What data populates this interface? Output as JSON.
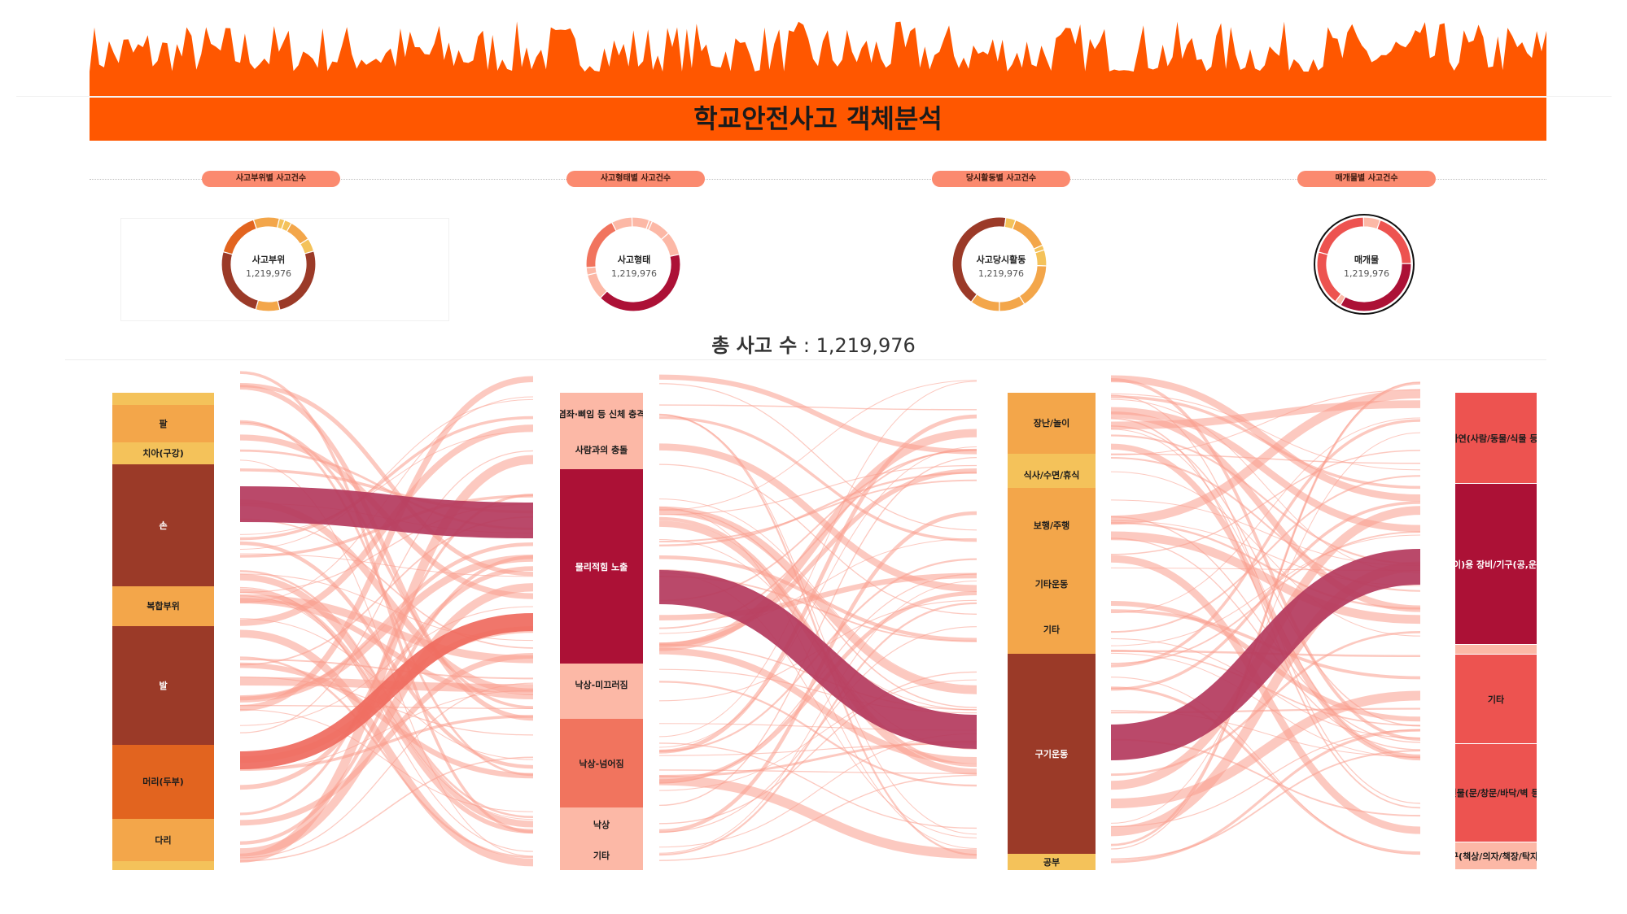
{
  "title": "학교안전사고 객체분석",
  "total": {
    "label": "총 사고 수",
    "value": "1,219,976"
  },
  "donuts": [
    {
      "pill": "사고부위별 사고건수",
      "center": "사고부위",
      "value": "1,219,976"
    },
    {
      "pill": "사고형태별 사고건수",
      "center": "사고형태",
      "value": "1,219,976"
    },
    {
      "pill": "당시활동별 사고건수",
      "center": "사고당시활동",
      "value": "1,219,976"
    },
    {
      "pill": "매개물별 사고건수",
      "center": "매개물",
      "value": "1,219,976"
    }
  ],
  "colors": {
    "accent": "#ff5700",
    "flow": "#fa9d8c",
    "flow_highlight_1": "#b43a5d",
    "flow_highlight_2": "#ef6a5e"
  },
  "chart_data": {
    "type": "sankey",
    "stages": [
      {
        "name": "사고부위",
        "nodes": [
          {
            "label": "",
            "value": 12000,
            "color": "#f4c25a"
          },
          {
            "label": "팔",
            "value": 38000,
            "color": "#f3a64a"
          },
          {
            "label": "치아(구강)",
            "value": 22000,
            "color": "#f4c25a"
          },
          {
            "label": "손",
            "value": 124000,
            "color": "#9b3a28"
          },
          {
            "label": "복합부위",
            "value": 40000,
            "color": "#f3a64a"
          },
          {
            "label": "발",
            "value": 120000,
            "color": "#9b3a28"
          },
          {
            "label": "머리(두부)",
            "value": 75000,
            "color": "#e2641f"
          },
          {
            "label": "다리",
            "value": 43000,
            "color": "#f3a64a"
          },
          {
            "label": "",
            "value": 9000,
            "color": "#f4c25a"
          }
        ]
      },
      {
        "name": "사고형태",
        "nodes": [
          {
            "label": "",
            "value": 5000,
            "color": "#fcb8a6"
          },
          {
            "label": "염좌·삐임 등 신체 충격",
            "value": 32000,
            "color": "#fcb8a6"
          },
          {
            "label": "사람과의 충돌",
            "value": 38000,
            "color": "#fcb8a6"
          },
          {
            "label": "물리적힘 노출",
            "value": 190000,
            "color": "#ac1136"
          },
          {
            "label": "낙상-미끄러짐",
            "value": 42000,
            "color": "#fcb8a6"
          },
          {
            "label": "",
            "value": 12000,
            "color": "#fcb8a6"
          },
          {
            "label": "낙상-넘어짐",
            "value": 87000,
            "color": "#f1745e"
          },
          {
            "label": "낙상",
            "value": 33000,
            "color": "#fcb8a6"
          },
          {
            "label": "기타",
            "value": 28000,
            "color": "#fcb8a6"
          }
        ]
      },
      {
        "name": "사고당시활동",
        "nodes": [
          {
            "label": "장난/놀이",
            "value": 60000,
            "color": "#f3a64a"
          },
          {
            "label": "",
            "value": 8000,
            "color": "#f4c25a"
          },
          {
            "label": "식사/수면/휴식",
            "value": 26000,
            "color": "#f4c25a"
          },
          {
            "label": "보행/주행",
            "value": 73000,
            "color": "#f3a64a"
          },
          {
            "label": "기타운동",
            "value": 42000,
            "color": "#f3a64a"
          },
          {
            "label": "기타",
            "value": 48000,
            "color": "#f3a64a"
          },
          {
            "label": "구기운동",
            "value": 197000,
            "color": "#9b3a28"
          },
          {
            "label": "공부",
            "value": 16000,
            "color": "#f4c25a"
          }
        ]
      },
      {
        "name": "매개물",
        "nodes": [
          {
            "label": "자연(사람/동물/식물 등)",
            "value": 90000,
            "color": "#ed5350"
          },
          {
            "label": "운동(놀이)용 장비/기구(공,운",
            "value": 158000,
            "color": "#ac1136"
          },
          {
            "label": "",
            "value": 10000,
            "color": "#fcb8a6"
          },
          {
            "label": "기타",
            "value": 88000,
            "color": "#ed5350"
          },
          {
            "label": "건물(문/창문/바닥/벽 등)",
            "value": 97000,
            "color": "#ed5350"
          },
          {
            "label": "가구(책상/의자/책장/탁자/침",
            "value": 27000,
            "color": "#fcb8a6"
          }
        ]
      }
    ]
  }
}
